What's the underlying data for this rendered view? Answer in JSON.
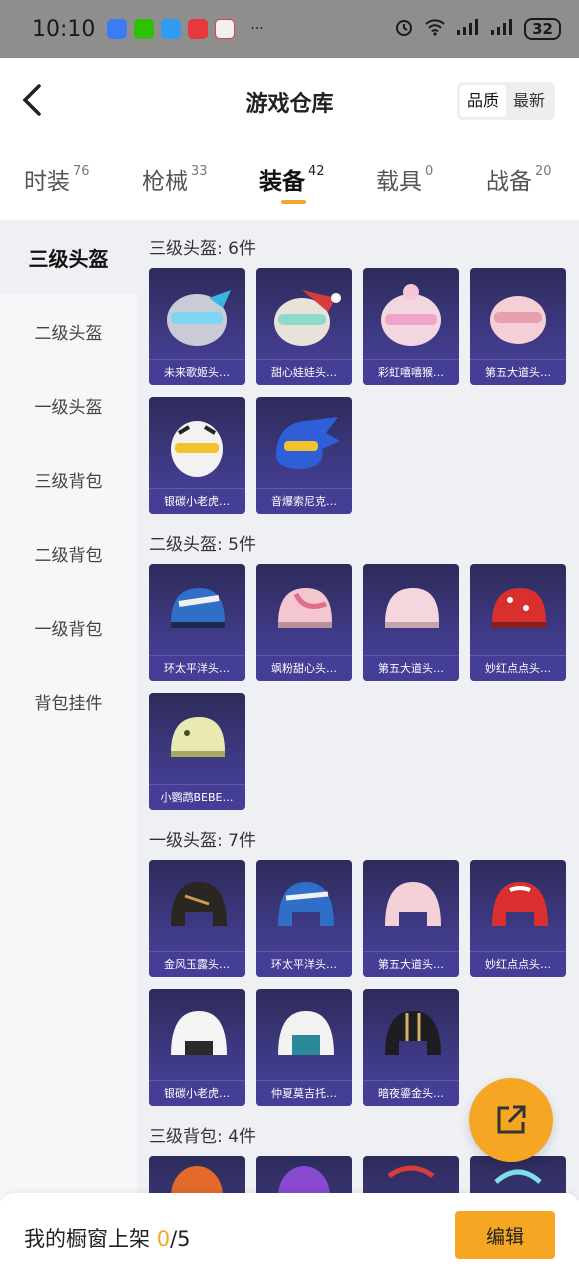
{
  "status_bar": {
    "time": "10:10",
    "dots": "···",
    "battery": "32"
  },
  "header": {
    "title": "游戏仓库",
    "sort_options": [
      "品质",
      "最新"
    ]
  },
  "tabs": [
    {
      "label": "时装",
      "count": "76"
    },
    {
      "label": "枪械",
      "count": "33"
    },
    {
      "label": "装备",
      "count": "42"
    },
    {
      "label": "载具",
      "count": "0"
    },
    {
      "label": "战备",
      "count": "20"
    }
  ],
  "sidebar": [
    "三级头盔",
    "二级头盔",
    "一级头盔",
    "三级背包",
    "二级背包",
    "一级背包",
    "背包挂件"
  ],
  "sections": [
    {
      "title": "三级头盔: 6件",
      "items": [
        "未来歌姬头…",
        "甜心娃娃头…",
        "彩虹嘻嘻猴…",
        "第五大道头…",
        "银碳小老虎…",
        "音爆索尼克…"
      ]
    },
    {
      "title": "二级头盔: 5件",
      "items": [
        "环太平洋头…",
        "飒粉甜心头…",
        "第五大道头…",
        "妙红点点头…",
        "小鹦鹉BEBE…"
      ]
    },
    {
      "title": "一级头盔: 7件",
      "items": [
        "金风玉露头…",
        "环太平洋头…",
        "第五大道头…",
        "妙红点点头…",
        "银碳小老虎…",
        "仲夏莫吉托…",
        "暗夜鎏金头…"
      ]
    },
    {
      "title": "三级背包: 4件",
      "items": [
        "",
        "",
        "",
        ""
      ]
    }
  ],
  "bottom_bar": {
    "label": "我的橱窗上架 ",
    "current": "0",
    "total": "/5",
    "edit_button": "编辑"
  },
  "colors": {
    "accent": "#f5a623",
    "card_bg": "#3f3a86",
    "content_bg": "#eef0f3"
  }
}
